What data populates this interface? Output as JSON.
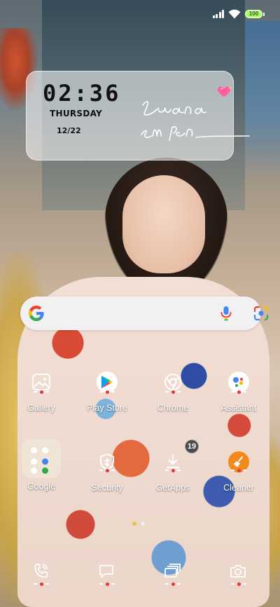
{
  "status_bar": {
    "battery_level": "100",
    "battery_color": "#a8ff5f"
  },
  "clock_widget": {
    "time": "02:36",
    "day": "THURSDAY",
    "date": "12/22",
    "signature_text": "Luana em Pen",
    "decoration_icon": "sparkling-heart-icon"
  },
  "search_bar": {
    "logo_icon": "google-g-logo",
    "mic_icon": "microphone-icon",
    "lens_icon": "google-lens-icon"
  },
  "apps": [
    {
      "label": "Gallery",
      "icon": "gallery-icon"
    },
    {
      "label": "Play Store",
      "icon": "play-store-icon"
    },
    {
      "label": "Chrome",
      "icon": "chrome-icon"
    },
    {
      "label": "Assistant",
      "icon": "assistant-icon"
    },
    {
      "label": "Google",
      "icon": "folder-icon"
    },
    {
      "label": "Security",
      "icon": "security-shield-icon"
    },
    {
      "label": "GetApps",
      "icon": "download-icon",
      "badge": "19"
    },
    {
      "label": "Cleaner",
      "icon": "broom-icon",
      "accent": "#f08a1c"
    }
  ],
  "page_indicator": {
    "pages": 2,
    "active_index": 0
  },
  "dock": [
    {
      "icon": "phone-icon"
    },
    {
      "icon": "messages-icon"
    },
    {
      "icon": "recent-apps-icon"
    },
    {
      "icon": "camera-icon"
    }
  ]
}
